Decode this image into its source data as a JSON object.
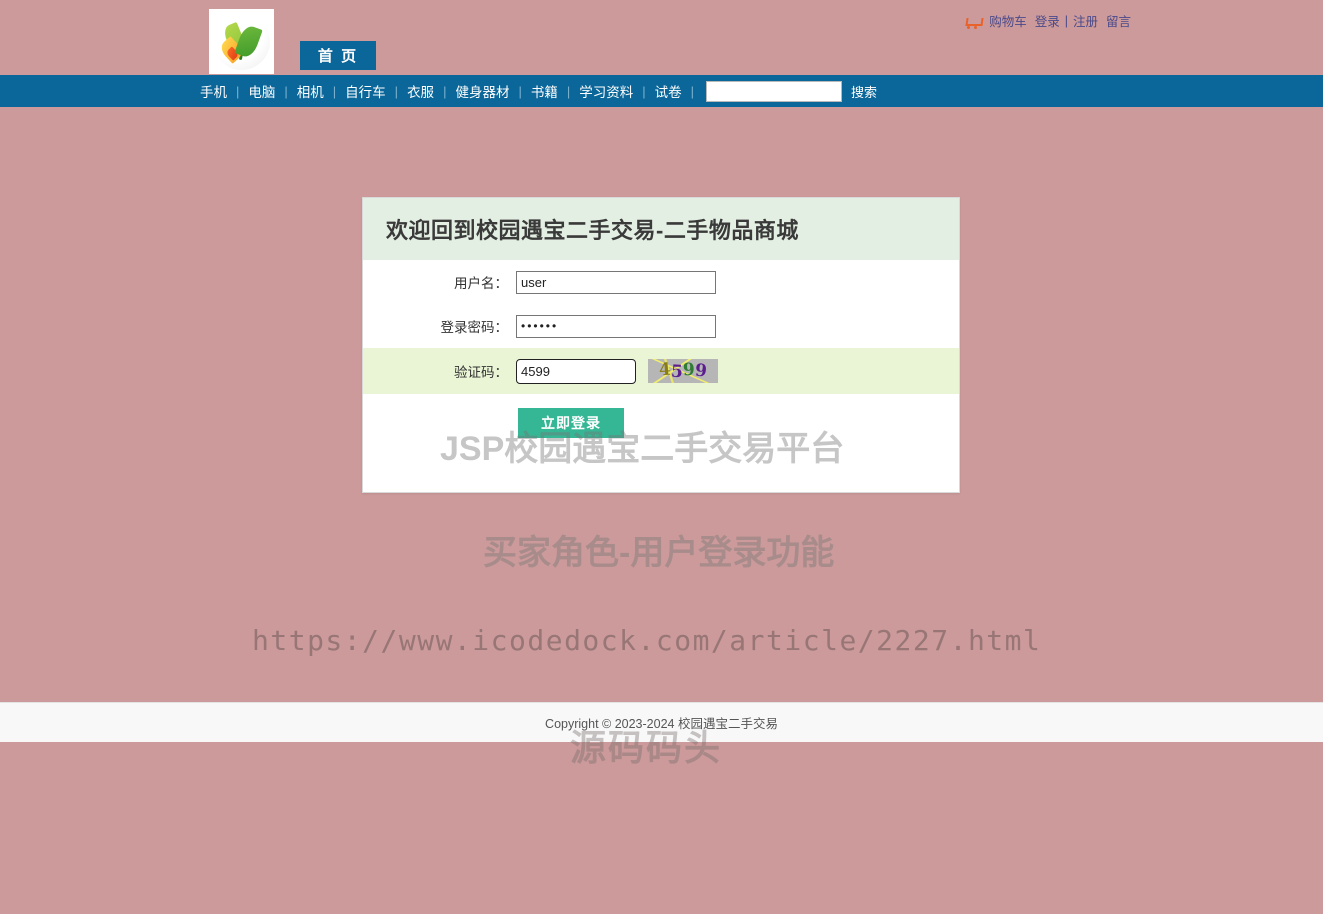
{
  "topbar": {
    "cart_icon": "shopping-cart-icon",
    "cart_label": "购物车",
    "login_label": "登录",
    "separator": "|",
    "register_label": "注册",
    "message_label": "留言"
  },
  "brand": {
    "logo_icon": "leaf-logo-icon",
    "home_tab_label": "首 页"
  },
  "nav": {
    "items": [
      {
        "label": "手机"
      },
      {
        "label": "电脑"
      },
      {
        "label": "相机"
      },
      {
        "label": "自行车"
      },
      {
        "label": "衣服"
      },
      {
        "label": "健身器材"
      },
      {
        "label": "书籍"
      },
      {
        "label": "学习资料"
      },
      {
        "label": "试卷"
      }
    ],
    "divider": "|",
    "search_value": "",
    "search_placeholder": "",
    "search_button_label": "搜索"
  },
  "login_card": {
    "title": "欢迎回到校园遇宝二手交易-二手物品商城",
    "fields": {
      "username_label": "用户名：",
      "username_value": "user",
      "password_label": "登录密码：",
      "password_value": "••••••",
      "captcha_label": "验证码：",
      "captcha_value": "4599"
    },
    "captcha_image": {
      "name": "captcha-image",
      "digits": [
        "4",
        "5",
        "9",
        "9"
      ],
      "colors": [
        "#8a7d18",
        "#5c1d8e",
        "#2e7d32",
        "#5c1d8e"
      ],
      "background": "#b6b6b6"
    },
    "submit_label": "立即登录",
    "submit_color": "#35b695"
  },
  "watermarks": {
    "platform": "JSP校园遇宝二手交易平台",
    "role": "买家角色-用户登录功能",
    "url": "https://www.icodedock.com/article/2227.html",
    "site": "源码码头"
  },
  "footer": {
    "copyright": "Copyright © 2023-2024 校园遇宝二手交易"
  },
  "theme": {
    "page_background": "#cc9a9a",
    "nav_blue": "#0b6699",
    "header_green": "#e4efe3",
    "captcha_row_green": "#e9f5d5",
    "link_color": "#4a4a8a"
  }
}
